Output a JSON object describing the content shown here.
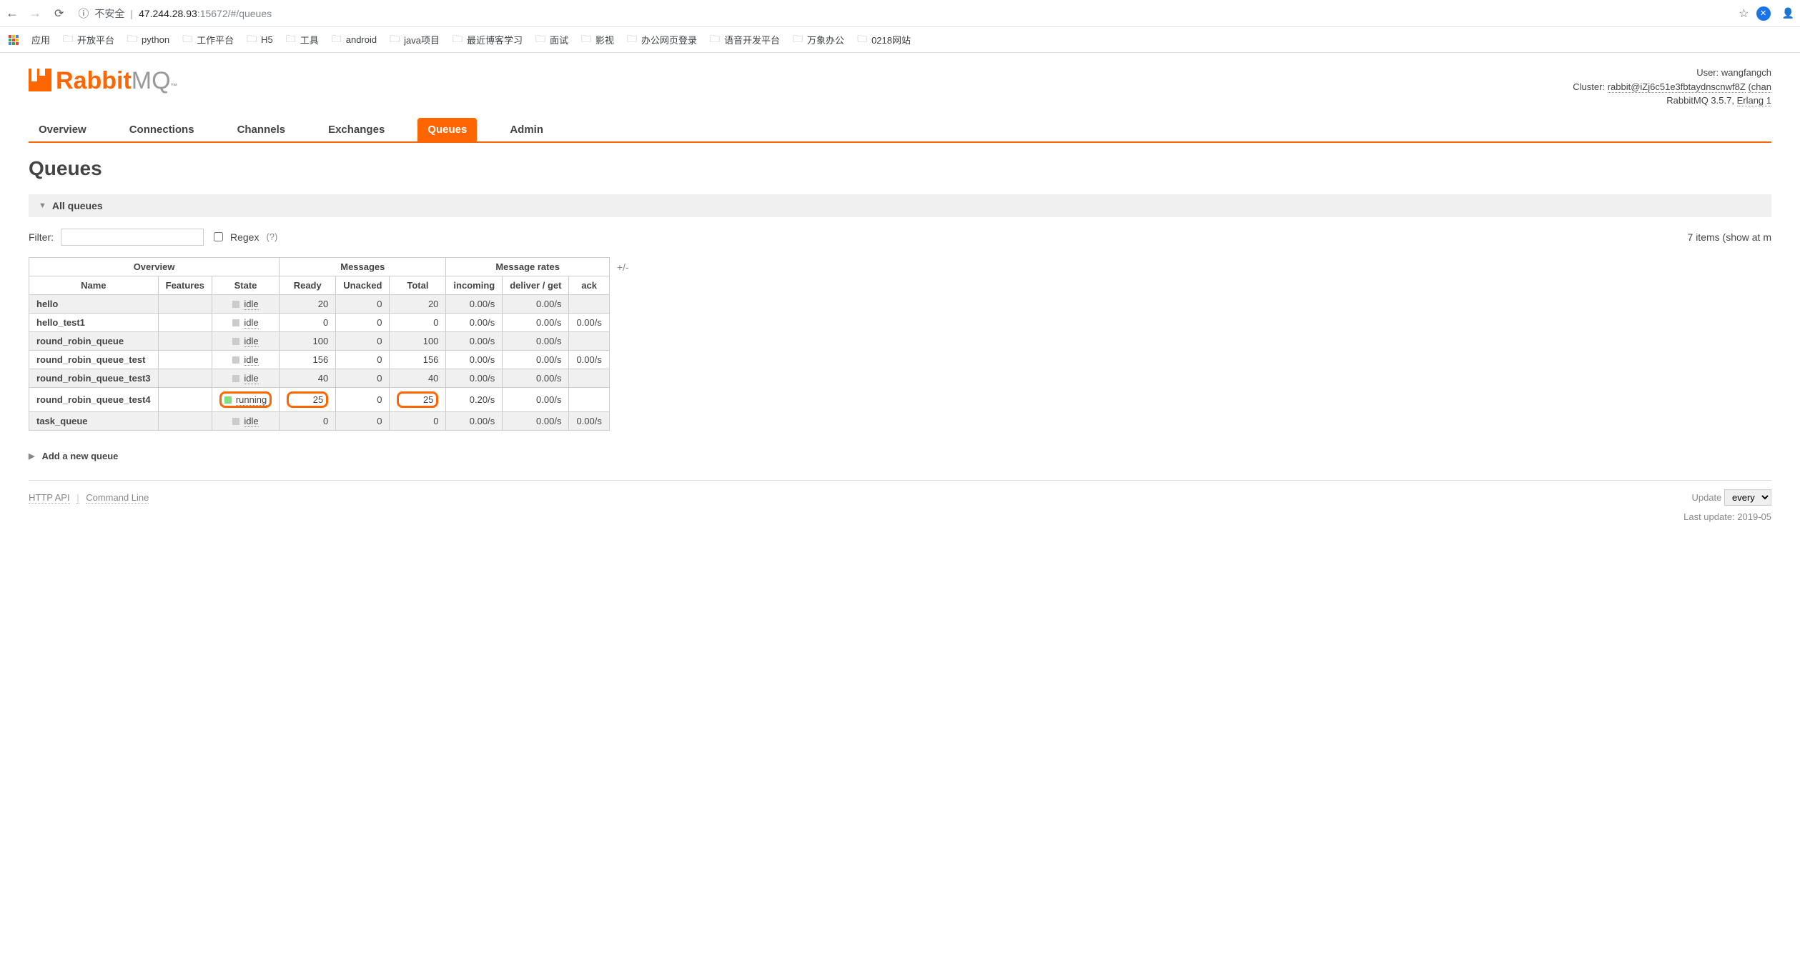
{
  "browser": {
    "url_unsafe": "不安全",
    "url_sep": "|",
    "url_host": "47.244.28.93",
    "url_port_path": ":15672/#/queues"
  },
  "bookmarks": {
    "apps": "应用",
    "items": [
      "开放平台",
      "python",
      "工作平台",
      "H5",
      "工具",
      "android",
      "java项目",
      "最近博客学习",
      "面试",
      "影视",
      "办公网页登录",
      "语音开发平台",
      "万象办公",
      "0218网站"
    ]
  },
  "logo": {
    "rabbit": "Rabbit",
    "mq": "MQ",
    "tm": "™"
  },
  "header_info": {
    "user_label": "User:",
    "user": "wangfangch",
    "cluster_label": "Cluster:",
    "cluster": "rabbit@iZj6c51e3fbtaydnscnwf8Z",
    "change": "(chan",
    "version": "RabbitMQ 3.5.7,",
    "erlang": "Erlang 1"
  },
  "tabs": [
    "Overview",
    "Connections",
    "Channels",
    "Exchanges",
    "Queues",
    "Admin"
  ],
  "active_tab": "Queues",
  "page_title": "Queues",
  "section_all_queues": "All queues",
  "filter": {
    "label": "Filter:",
    "regex": "Regex",
    "help": "(?)"
  },
  "items_text": "7 items (show at m",
  "table": {
    "group_headers": [
      "Overview",
      "Messages",
      "Message rates"
    ],
    "plusminus": "+/-",
    "columns": [
      "Name",
      "Features",
      "State",
      "Ready",
      "Unacked",
      "Total",
      "incoming",
      "deliver / get",
      "ack"
    ],
    "rows": [
      {
        "name": "hello",
        "state": "idle",
        "running": false,
        "ready": "20",
        "unacked": "0",
        "total": "20",
        "incoming": "0.00/s",
        "deliver": "0.00/s",
        "ack": "",
        "odd": true,
        "hl": false
      },
      {
        "name": "hello_test1",
        "state": "idle",
        "running": false,
        "ready": "0",
        "unacked": "0",
        "total": "0",
        "incoming": "0.00/s",
        "deliver": "0.00/s",
        "ack": "0.00/s",
        "odd": false,
        "hl": false
      },
      {
        "name": "round_robin_queue",
        "state": "idle",
        "running": false,
        "ready": "100",
        "unacked": "0",
        "total": "100",
        "incoming": "0.00/s",
        "deliver": "0.00/s",
        "ack": "",
        "odd": true,
        "hl": false
      },
      {
        "name": "round_robin_queue_test",
        "state": "idle",
        "running": false,
        "ready": "156",
        "unacked": "0",
        "total": "156",
        "incoming": "0.00/s",
        "deliver": "0.00/s",
        "ack": "0.00/s",
        "odd": false,
        "hl": false
      },
      {
        "name": "round_robin_queue_test3",
        "state": "idle",
        "running": false,
        "ready": "40",
        "unacked": "0",
        "total": "40",
        "incoming": "0.00/s",
        "deliver": "0.00/s",
        "ack": "",
        "odd": true,
        "hl": false
      },
      {
        "name": "round_robin_queue_test4",
        "state": "running",
        "running": true,
        "ready": "25",
        "unacked": "0",
        "total": "25",
        "incoming": "0.20/s",
        "deliver": "0.00/s",
        "ack": "",
        "odd": false,
        "hl": true
      },
      {
        "name": "task_queue",
        "state": "idle",
        "running": false,
        "ready": "0",
        "unacked": "0",
        "total": "0",
        "incoming": "0.00/s",
        "deliver": "0.00/s",
        "ack": "0.00/s",
        "odd": true,
        "hl": false
      }
    ]
  },
  "add_queue": "Add a new queue",
  "footer": {
    "http_api": "HTTP API",
    "cmd_line": "Command Line",
    "update_label": "Update",
    "update_select": "every",
    "last_update": "Last update: 2019-05"
  }
}
